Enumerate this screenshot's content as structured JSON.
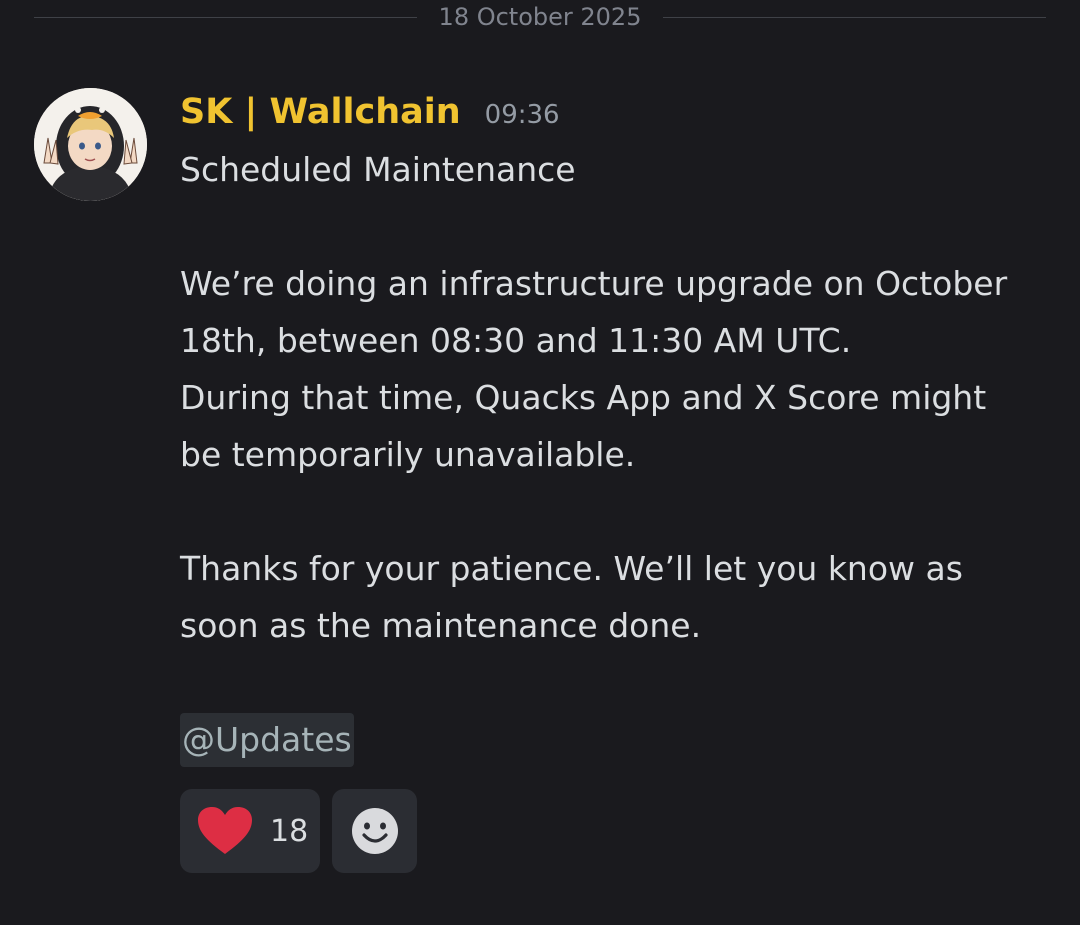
{
  "date_divider": "18 October 2025",
  "message": {
    "author": "SK | Wallchain",
    "time": "09:36",
    "lines": [
      "Scheduled Maintenance",
      "",
      "We’re doing an infrastructure upgrade on October",
      "18th, between 08:30 and 11:30 AM UTC.",
      "During that time, Quacks App and X Score might",
      "be temporarily unavailable.",
      "",
      "Thanks for your patience. We’ll let you know as",
      "soon as the maintenance done.",
      ""
    ],
    "mention": "@Updates"
  },
  "reactions": [
    {
      "icon": "heart-icon",
      "count": "18",
      "color": "#dd2e44"
    }
  ],
  "add_reaction_icon": "smiley-icon",
  "colors": {
    "background": "#1a1a1e",
    "username": "#f0c330",
    "mention_bg": "#2c2f34",
    "reaction_bg": "#2b2d33"
  }
}
